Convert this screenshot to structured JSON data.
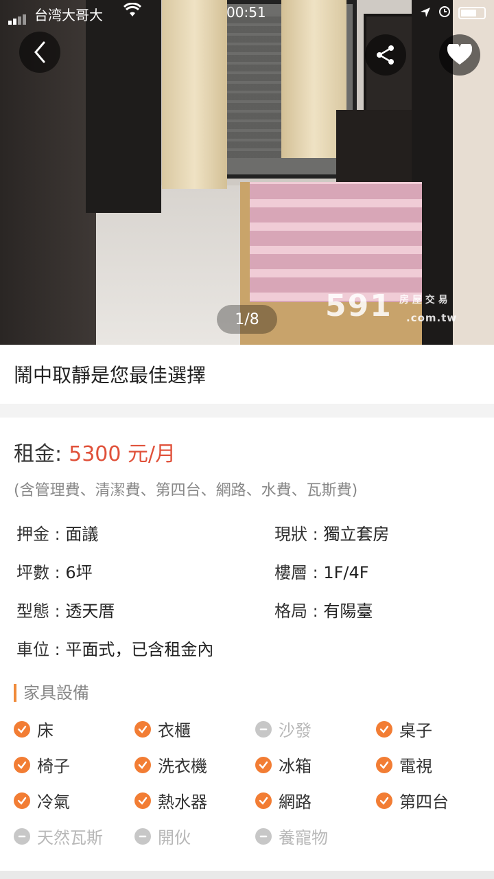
{
  "status": {
    "carrier": "台湾大哥大",
    "time": "00:51"
  },
  "gallery": {
    "counter": "1/8",
    "watermark_brand": "591",
    "watermark_text": "房 屋 交 易",
    "watermark_domain": ".com.tw"
  },
  "listing": {
    "title": "鬧中取靜是您最佳選擇",
    "rent_label": "租金:",
    "rent_value": "5300 元/月",
    "rent_color": "#e0513a",
    "includes": "(含管理費、清潔費、第四台、網路、水費、瓦斯費)"
  },
  "details": [
    {
      "label": "押金",
      "value": "面議"
    },
    {
      "label": "現狀",
      "value": "獨立套房"
    },
    {
      "label": "坪數",
      "value": "6坪"
    },
    {
      "label": "樓層",
      "value": "1F/4F"
    },
    {
      "label": "型態",
      "value": "透天厝"
    },
    {
      "label": "格局",
      "value": "有陽臺"
    },
    {
      "label": "車位",
      "value": "平面式，已含租金內"
    }
  ],
  "facilities": {
    "title": "家具設備",
    "accent": "#f27d34",
    "items": [
      {
        "label": "床",
        "available": true
      },
      {
        "label": "衣櫃",
        "available": true
      },
      {
        "label": "沙發",
        "available": false
      },
      {
        "label": "桌子",
        "available": true
      },
      {
        "label": "椅子",
        "available": true
      },
      {
        "label": "洗衣機",
        "available": true
      },
      {
        "label": "冰箱",
        "available": true
      },
      {
        "label": "電視",
        "available": true
      },
      {
        "label": "冷氣",
        "available": true
      },
      {
        "label": "熱水器",
        "available": true
      },
      {
        "label": "網路",
        "available": true
      },
      {
        "label": "第四台",
        "available": true
      },
      {
        "label": "天然瓦斯",
        "available": false
      },
      {
        "label": "開伙",
        "available": false
      },
      {
        "label": "養寵物",
        "available": false
      }
    ]
  }
}
